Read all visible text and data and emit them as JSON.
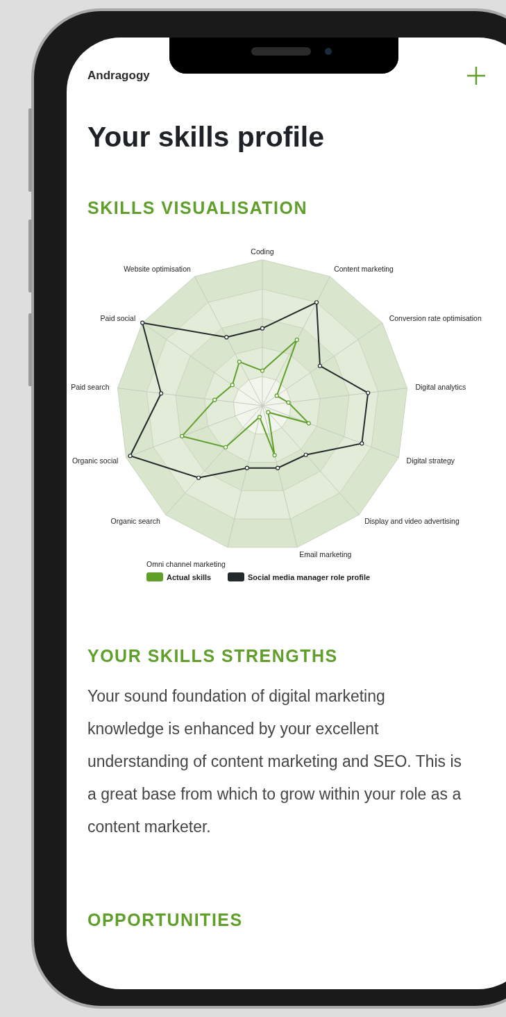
{
  "header": {
    "brand": "Andragogy"
  },
  "title": "Your skills profile",
  "visualisation": {
    "heading": "SKILLS VISUALISATION",
    "axes": {
      "top": "Coding",
      "right": [
        "Content marketing",
        "Conversion rate optimisation",
        "Digital analytics",
        "Digital strategy",
        "Display and video advertising"
      ],
      "bottom": [
        "Omni channel marketing",
        "Email marketing"
      ],
      "left": [
        "Website optimisation",
        "Paid social",
        "Paid search",
        "Organic social",
        "Organic search"
      ]
    },
    "legend": [
      {
        "label": "Actual skills",
        "color": "#5f9f2a"
      },
      {
        "label": "Social media manager role profile",
        "color": "#24292c"
      }
    ]
  },
  "strengths": {
    "heading": "YOUR SKILLS STRENGTHS",
    "text": "Your sound foundation of digital marketing knowledge is enhanced by your excellent understanding of content marketing and SEO. This is a great base from which to grow within your role as a content marketer."
  },
  "opportunities": {
    "heading": "OPPORTUNITIES"
  }
}
